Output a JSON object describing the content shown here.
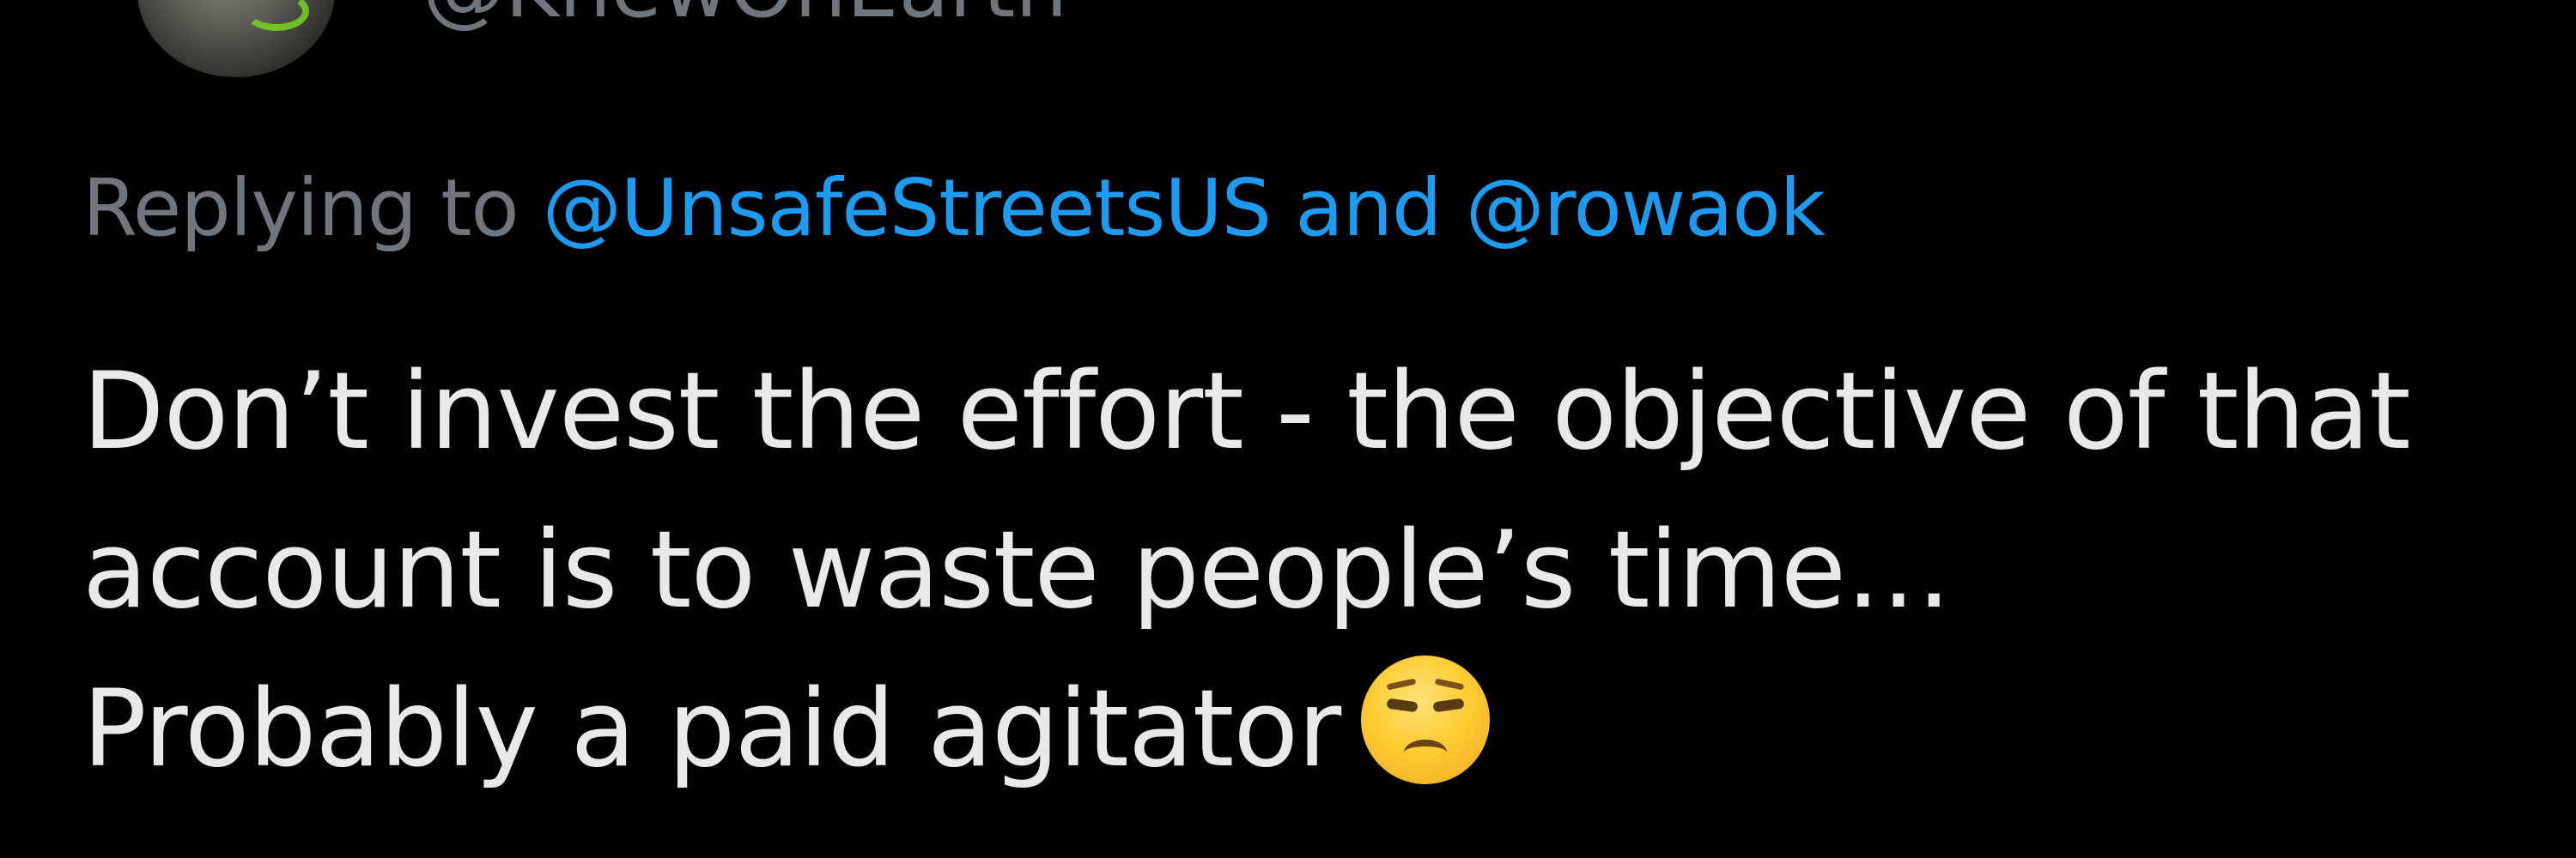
{
  "tweet": {
    "author_handle": "@KnewOnEarth",
    "avatar_icon": "profile-avatar",
    "replying_prefix": "Replying to",
    "reply_mention_1": "@UnsafeStreetsUS",
    "reply_connector": "and",
    "reply_mention_2": "@rowaok",
    "text_line_1": "Don’t invest the effort - the objective of that",
    "text_line_2": "account is to waste people’s time…",
    "text_line_3": "Probably a paid agitator",
    "emoji_icon": "unamused-face-emoji"
  },
  "colors": {
    "background": "#000000",
    "text": "#e7e9ea",
    "secondary_text": "#71767b",
    "link": "#1d9bf0"
  }
}
